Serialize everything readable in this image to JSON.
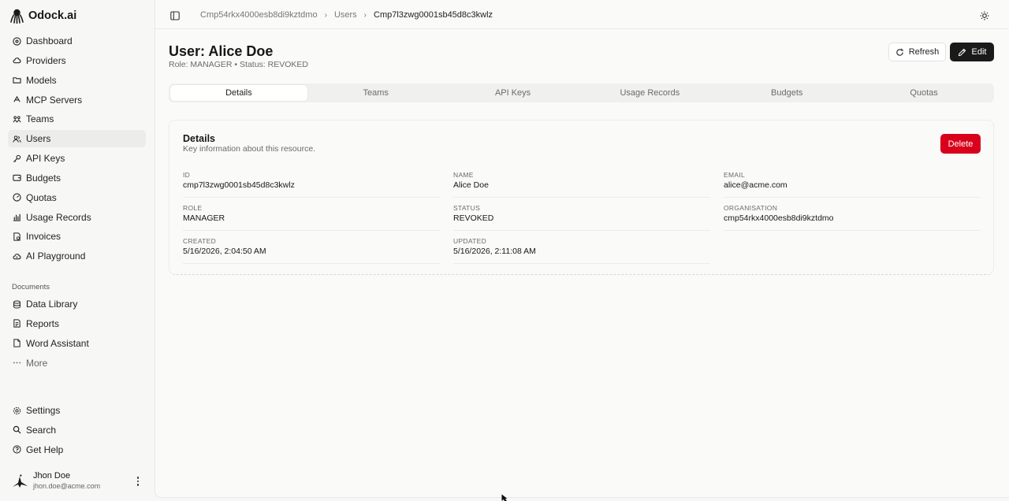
{
  "brand": {
    "name": "Odock.ai"
  },
  "sidebar": {
    "items": [
      {
        "label": "Dashboard",
        "icon": "dashboard-icon"
      },
      {
        "label": "Providers",
        "icon": "cloud-icon"
      },
      {
        "label": "Models",
        "icon": "folder-icon"
      },
      {
        "label": "MCP Servers",
        "icon": "server-icon"
      },
      {
        "label": "Teams",
        "icon": "teams-icon"
      },
      {
        "label": "Users",
        "icon": "users-icon",
        "active": true
      },
      {
        "label": "API Keys",
        "icon": "key-icon"
      },
      {
        "label": "Budgets",
        "icon": "wallet-icon"
      },
      {
        "label": "Quotas",
        "icon": "gauge-icon"
      },
      {
        "label": "Usage Records",
        "icon": "bar-chart-icon"
      },
      {
        "label": "Invoices",
        "icon": "invoice-icon"
      },
      {
        "label": "AI Playground",
        "icon": "sparkle-cloud-icon"
      }
    ],
    "documents_label": "Documents",
    "documents": [
      {
        "label": "Data Library",
        "icon": "database-icon"
      },
      {
        "label": "Reports",
        "icon": "report-icon"
      },
      {
        "label": "Word Assistant",
        "icon": "document-icon"
      },
      {
        "label": "More",
        "icon": "ellipsis-icon"
      }
    ],
    "bottom": [
      {
        "label": "Settings",
        "icon": "gear-icon"
      },
      {
        "label": "Search",
        "icon": "search-icon"
      },
      {
        "label": "Get Help",
        "icon": "help-icon"
      }
    ],
    "user": {
      "name": "Jhon Doe",
      "email": "jhon.doe@acme.com"
    }
  },
  "breadcrumb": [
    "Cmp54rkx4000esb8di9kztdmo",
    "Users",
    "Cmp7l3zwg0001sb45d8c3kwlz"
  ],
  "header": {
    "title": "User: Alice Doe",
    "subtitle": "Role: MANAGER • Status: REVOKED",
    "refresh_label": "Refresh",
    "edit_label": "Edit"
  },
  "tabs": [
    {
      "label": "Details",
      "active": true
    },
    {
      "label": "Teams"
    },
    {
      "label": "API Keys"
    },
    {
      "label": "Usage Records"
    },
    {
      "label": "Budgets"
    },
    {
      "label": "Quotas"
    }
  ],
  "card": {
    "title": "Details",
    "description": "Key information about this resource.",
    "delete_label": "Delete",
    "delete_color": "#d9001b",
    "fields": [
      {
        "label": "ID",
        "value": "cmp7l3zwg0001sb45d8c3kwlz"
      },
      {
        "label": "NAME",
        "value": "Alice Doe"
      },
      {
        "label": "EMAIL",
        "value": "alice@acme.com"
      },
      {
        "label": "ROLE",
        "value": "MANAGER"
      },
      {
        "label": "STATUS",
        "value": "REVOKED"
      },
      {
        "label": "ORGANISATION",
        "value": "cmp54rkx4000esb8di9kztdmo"
      },
      {
        "label": "CREATED",
        "value": "5/16/2026, 2:04:50 AM"
      },
      {
        "label": "UPDATED",
        "value": "5/16/2026, 2:11:08 AM"
      }
    ]
  }
}
